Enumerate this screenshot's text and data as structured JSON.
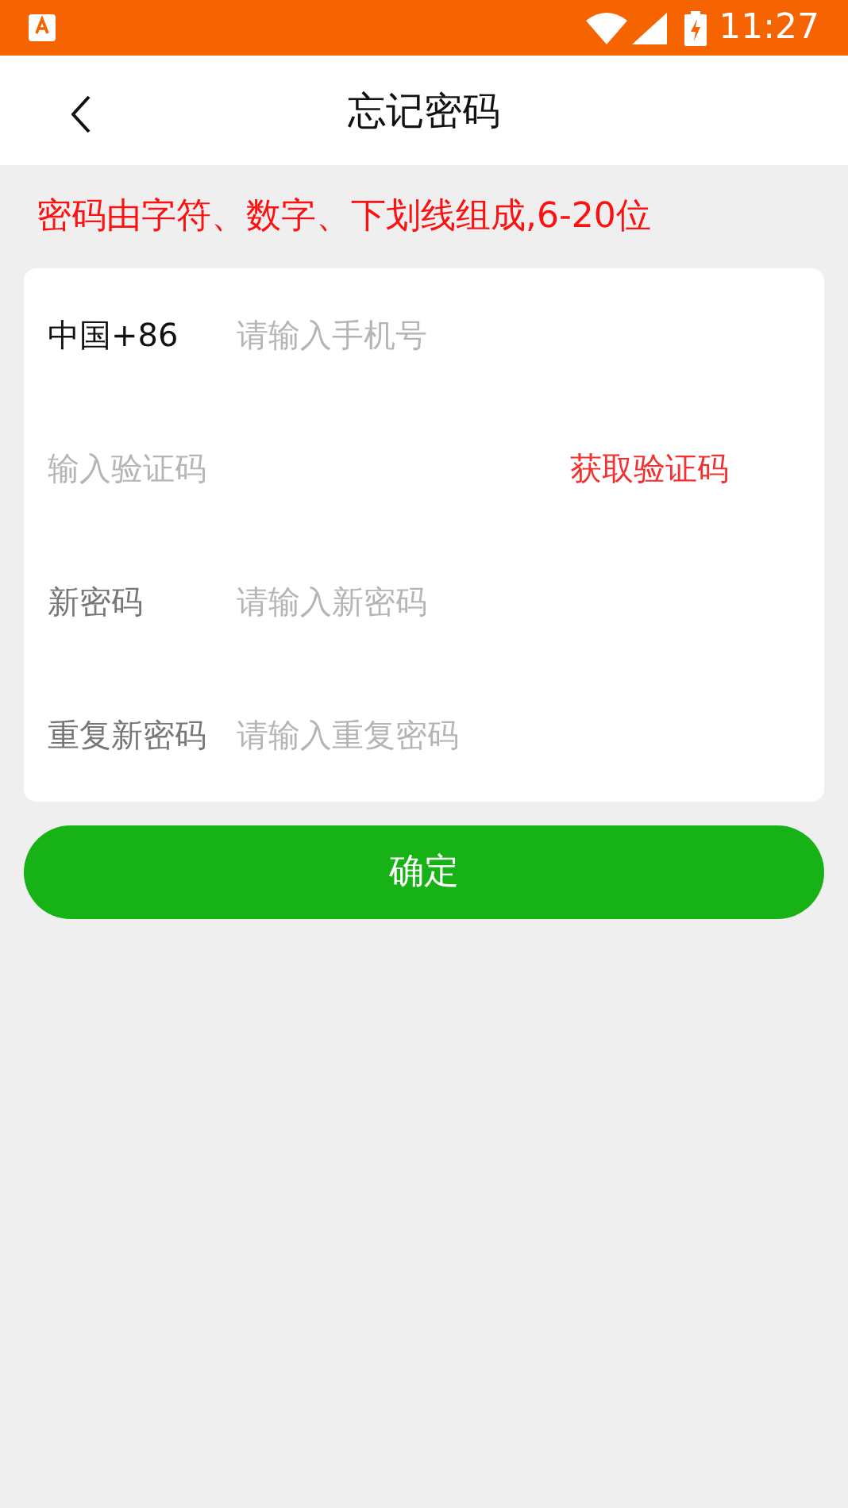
{
  "status_bar": {
    "time": "11:27"
  },
  "header": {
    "title": "忘记密码"
  },
  "hint": "密码由字符、数字、下划线组成,6-20位",
  "fields": [
    {
      "kind": "phone",
      "label": "中国+86",
      "placeholder": "请输入手机号"
    },
    {
      "kind": "code",
      "placeholder": "输入验证码",
      "button": "获取验证码"
    },
    {
      "kind": "password",
      "label": "新密码",
      "placeholder": "请输入新密码"
    },
    {
      "kind": "password",
      "label": "重复新密码",
      "placeholder": "请输入重复密码"
    }
  ],
  "submit": "确定"
}
